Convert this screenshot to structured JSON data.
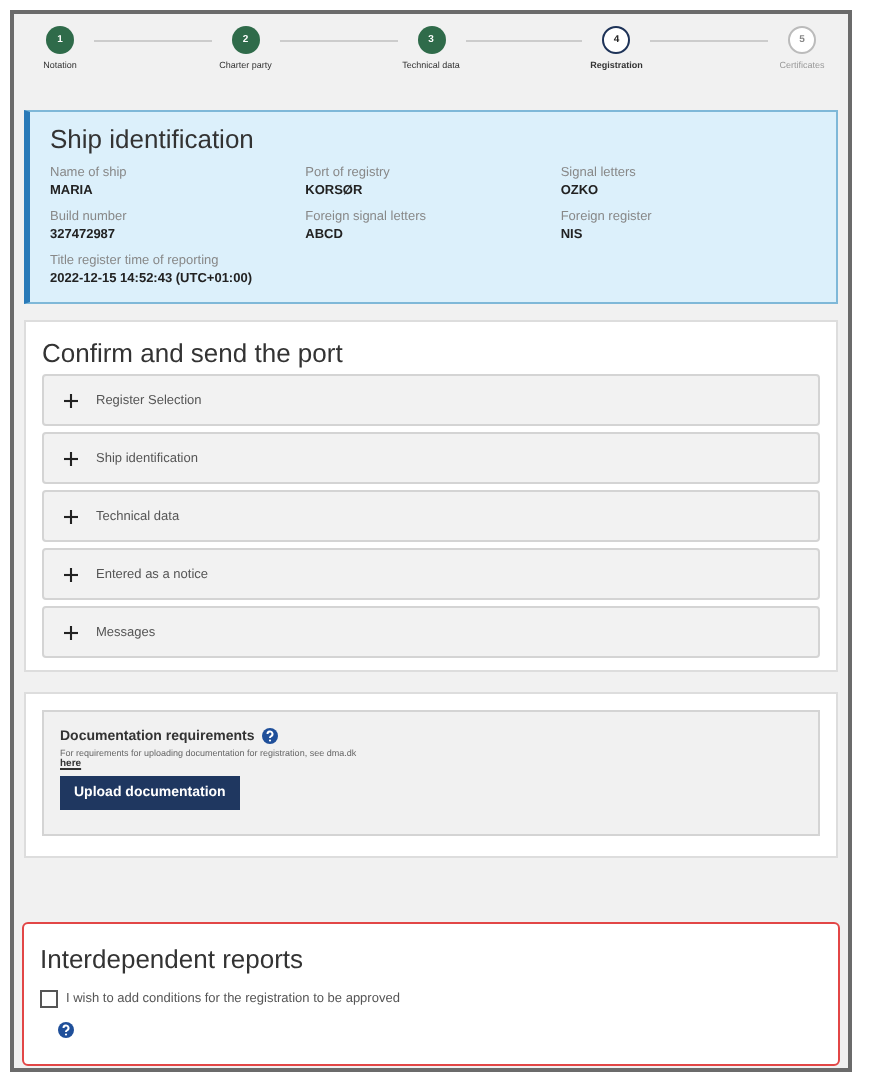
{
  "steps": [
    {
      "number": "1",
      "label": "Notation",
      "completed": true,
      "selected": false
    },
    {
      "number": "2",
      "label": "Charter party",
      "completed": true,
      "selected": false
    },
    {
      "number": "3",
      "label": "Technical data",
      "completed": true,
      "selected": false
    },
    {
      "number": "4",
      "label": "Registration",
      "completed": false,
      "selected": true
    },
    {
      "number": "5",
      "label": "Certificates",
      "completed": false,
      "selected": false
    }
  ],
  "ship_identification": {
    "title": "Ship identification",
    "fields": [
      {
        "label": "Name of ship",
        "value": "MARIA"
      },
      {
        "label": "Port of registry",
        "value": "KORSØR"
      },
      {
        "label": "Signal letters",
        "value": "OZKO"
      },
      {
        "label": "Build number",
        "value": "327472987"
      },
      {
        "label": "Foreign signal letters",
        "value": "ABCD"
      },
      {
        "label": "Foreign register",
        "value": "NIS"
      },
      {
        "label": "Title register time of reporting",
        "value": "2022-12-15 14:52:43 (UTC+01:00)"
      }
    ]
  },
  "confirm": {
    "title": "Confirm and send the port",
    "sections": [
      {
        "label": "Register Selection",
        "expanded": false
      },
      {
        "label": "Ship identification",
        "expanded": false
      },
      {
        "label": "Technical data",
        "expanded": false
      },
      {
        "label": "Entered as a notice",
        "expanded": false
      },
      {
        "label": "Messages",
        "expanded": false
      }
    ]
  },
  "documentation": {
    "title": "Documentation requirements",
    "text": "For requirements for uploading documentation for registration, see dma.dk",
    "link": "here",
    "button": "Upload documentation"
  },
  "interdependent": {
    "title": "Interdependent reports",
    "checkbox": {
      "label": "I wish to add conditions for the registration to be approved",
      "checked": false
    }
  }
}
